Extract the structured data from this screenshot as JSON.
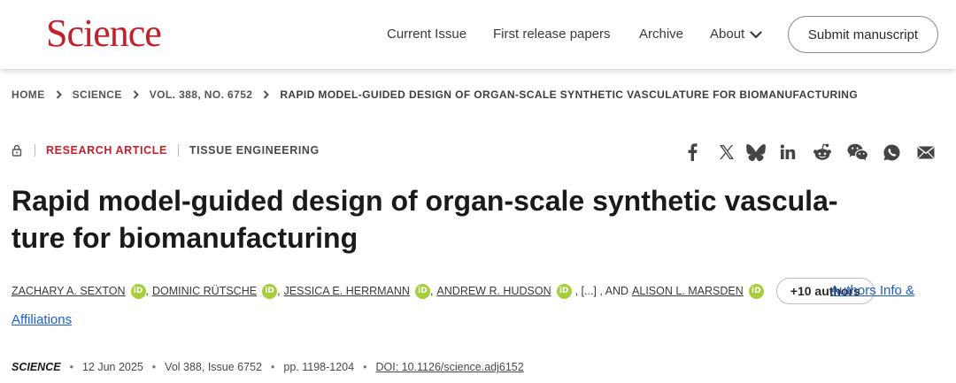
{
  "header": {
    "logo": "Science",
    "nav": [
      "Current Issue",
      "First release papers",
      "Archive",
      "About"
    ],
    "submit_label": "Submit manuscript"
  },
  "breadcrumb": [
    "HOME",
    "SCIENCE",
    "VOL. 388, NO. 6752",
    "RAPID MODEL-GUIDED DESIGN OF ORGAN-SCALE SYNTHETIC VASCULATURE FOR BIOMANUFACTURING"
  ],
  "article": {
    "type": "RESEARCH ARTICLE",
    "subject": "TISSUE ENGINEERING",
    "title": "Rapid model-guided design of organ-scale synthetic vascula-ture for biomanufacturing",
    "title_line1": "Rapid model-guided design of organ-scale synthetic vascula-",
    "title_line2": "ture for biomanufacturing"
  },
  "share_icons": [
    "facebook-icon",
    "x-icon",
    "bluesky-icon",
    "linkedin-icon",
    "reddit-icon",
    "wechat-icon",
    "whatsapp-icon",
    "email-icon"
  ],
  "authors": {
    "list": [
      "ZACHARY A. SEXTON",
      "DOMINIC RÜTSCHE",
      "JESSICA E. HERRMANN",
      "ANDREW R. HUDSON"
    ],
    "ellipsis": ", [...] , AND",
    "last": "ALISON L. MARSDEN",
    "more_label": "+10 authors",
    "affiliations_line1": "Authors Info &",
    "affiliations_line2": "Affiliations"
  },
  "citation": {
    "journal": "SCIENCE",
    "date": "12 Jun 2025",
    "volume": "Vol 388, Issue 6752",
    "pages": "pp. 1198-1204",
    "doi": "DOI: 10.1126/science.adj6152"
  },
  "colors": {
    "brand": "#c51f2a",
    "link": "#1a5fd0",
    "orcid": "#a6ce39"
  }
}
